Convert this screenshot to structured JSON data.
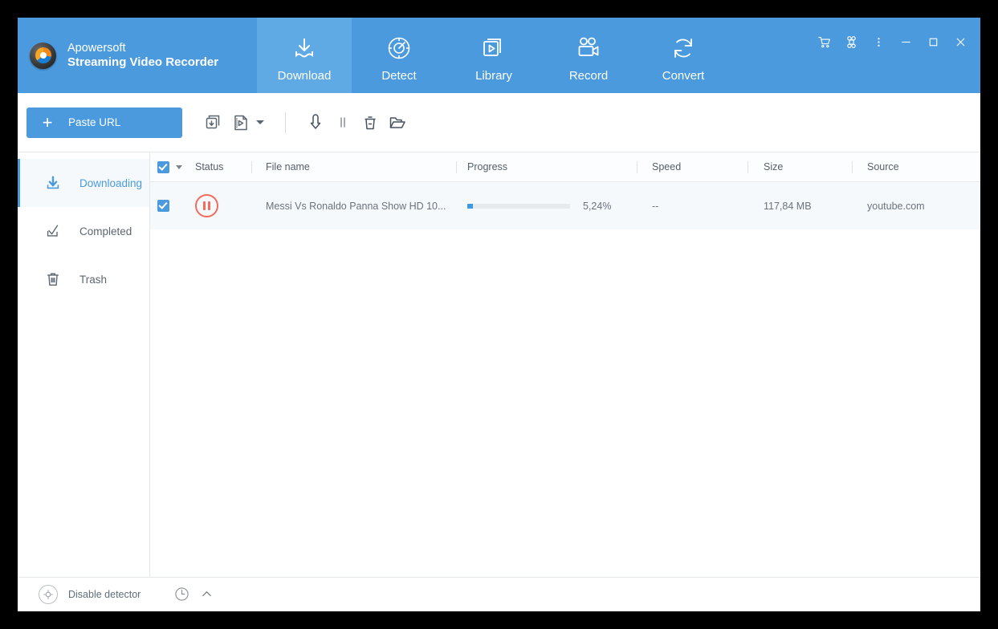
{
  "brand": {
    "company": "Apowersoft",
    "product": "Streaming Video Recorder",
    "logo_icon": "apowersoft-logo-icon"
  },
  "nav": {
    "tabs": [
      {
        "label": "Download",
        "icon": "download-tray-icon",
        "active": true
      },
      {
        "label": "Detect",
        "icon": "detect-radar-icon",
        "active": false
      },
      {
        "label": "Library",
        "icon": "library-play-icon",
        "active": false
      },
      {
        "label": "Record",
        "icon": "record-camera-icon",
        "active": false
      },
      {
        "label": "Convert",
        "icon": "convert-refresh-icon",
        "active": false
      }
    ]
  },
  "window_controls": [
    {
      "name": "cart-icon",
      "glyph": "cart"
    },
    {
      "name": "apps-grid-icon",
      "glyph": "command"
    },
    {
      "name": "more-options-icon",
      "glyph": "dots"
    },
    {
      "name": "minimize-icon",
      "glyph": "minimize"
    },
    {
      "name": "maximize-icon",
      "glyph": "maximize"
    },
    {
      "name": "close-icon",
      "glyph": "close"
    }
  ],
  "toolbar": {
    "paste_url_label": "Paste URL",
    "plus_glyph": "+",
    "icons": [
      {
        "name": "batch-download-icon"
      },
      {
        "name": "video-format-icon"
      },
      {
        "name": "format-dropdown-caret"
      },
      {
        "name": "start-download-icon"
      },
      {
        "name": "pause-download-icon"
      },
      {
        "name": "delete-icon"
      },
      {
        "name": "open-folder-icon"
      }
    ]
  },
  "sidebar": {
    "items": [
      {
        "label": "Downloading",
        "icon": "download-arrow-icon",
        "active": true
      },
      {
        "label": "Completed",
        "icon": "check-tray-icon",
        "active": false
      },
      {
        "label": "Trash",
        "icon": "trash-icon",
        "active": false
      }
    ]
  },
  "table": {
    "columns": {
      "status": "Status",
      "file_name": "File name",
      "progress": "Progress",
      "speed": "Speed",
      "size": "Size",
      "source": "Source"
    },
    "rows": [
      {
        "checked": true,
        "status_icon": "pause-status-icon",
        "file_name": "Messi Vs Ronaldo Panna Show HD 10...",
        "progress_percent": 5.24,
        "progress_label": "5,24%",
        "speed": "--",
        "size": "117,84 MB",
        "source": "youtube.com"
      }
    ]
  },
  "footer": {
    "detector_icon": "detector-target-icon",
    "detector_label": "Disable detector",
    "clock_icon": "clock-icon",
    "chevron_icon": "chevron-up-icon"
  },
  "colors": {
    "header_blue": "#4b9ade",
    "active_tab_blue": "#5faae5",
    "accent_blue": "#4b9ade",
    "progress_blue": "#3b9ae1",
    "pause_orange": "#f26b5b",
    "row_bg": "#f5f9fc"
  }
}
